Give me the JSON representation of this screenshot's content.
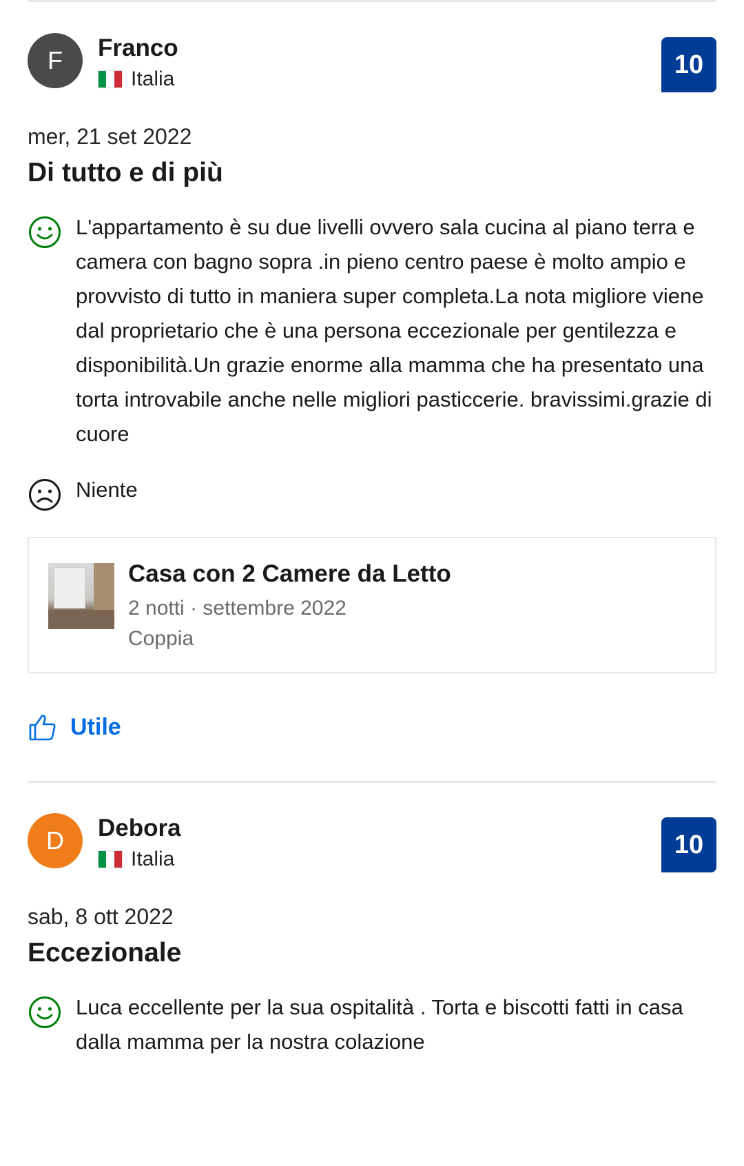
{
  "reviews": [
    {
      "avatar_letter": "F",
      "avatar_color": "#4a4a4a",
      "name": "Franco",
      "country": "Italia",
      "score": "10",
      "date": "mer, 21 set 2022",
      "title": "Di tutto e di più",
      "positive": "L'appartamento è su due livelli ovvero sala cucina al piano terra e camera con bagno sopra .in pieno centro paese è molto ampio e provvisto di tutto in maniera super completa.La nota migliore viene dal proprietario che è una persona eccezionale per gentilezza e disponibilità.Un grazie enorme alla mamma che ha presentato una torta introvabile anche nelle migliori pasticcerie. bravissimi.grazie di cuore",
      "negative": "Niente",
      "stay": {
        "room": "Casa con 2 Camere da Letto",
        "nights_date": "2 notti · settembre 2022",
        "traveler": "Coppia"
      },
      "helpful_label": "Utile"
    },
    {
      "avatar_letter": "D",
      "avatar_color": "#f07d19",
      "name": "Debora",
      "country": "Italia",
      "score": "10",
      "date": "sab, 8 ott 2022",
      "title": "Eccezionale",
      "positive": "Luca eccellente per la sua ospitalità . Torta e biscotti fatti in casa dalla mamma per la nostra colazione"
    }
  ],
  "colors": {
    "score_bg": "#003b95",
    "positive_icon": "#008009",
    "negative_icon": "#1a1a1a",
    "link": "#006ce4"
  },
  "icons": [
    "smile-icon",
    "frown-icon",
    "thumbs-up-icon",
    "italy-flag-icon"
  ]
}
